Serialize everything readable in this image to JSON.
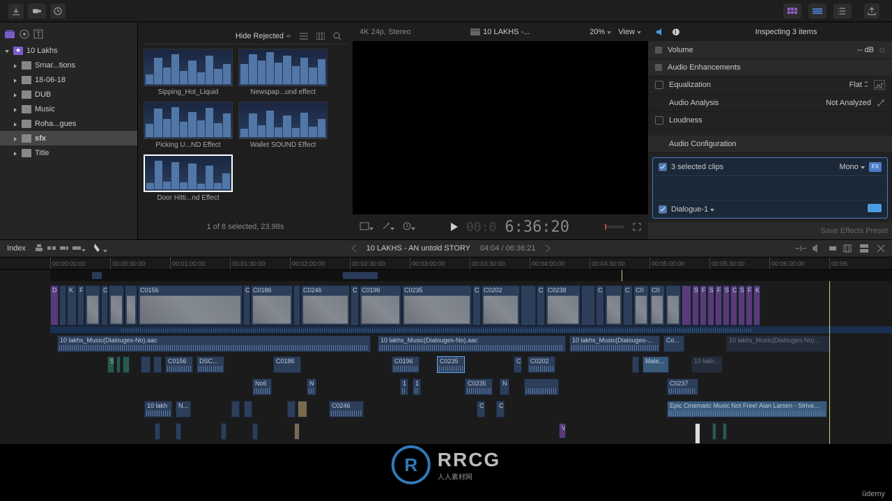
{
  "toolbar": {
    "hide_rejected": "Hide Rejected",
    "viewer_fmt": "4K 24p, Stereo",
    "project_name": "10 LAKHS -...",
    "zoom": "20%",
    "view": "View"
  },
  "sidebar": {
    "root": "10 Lakhs",
    "items": [
      {
        "label": "Smar...tions"
      },
      {
        "label": "18-06-18"
      },
      {
        "label": "DUB"
      },
      {
        "label": "Music"
      },
      {
        "label": "Roha...gues"
      },
      {
        "label": "sfx"
      },
      {
        "label": "Title"
      }
    ]
  },
  "browser": {
    "clips": [
      {
        "label": "Sipping_Hot_Liquid"
      },
      {
        "label": "Newspap...und effect"
      },
      {
        "label": "Picking U...ND Effect"
      },
      {
        "label": "Wallet SOUND Effect"
      },
      {
        "label": "Door Hitti...nd Effect"
      }
    ],
    "status": "1 of 8 selected, 23.98s"
  },
  "viewer": {
    "timecode": "6:36:20"
  },
  "inspector": {
    "title": "Inspecting 3 items",
    "volume_label": "Volume",
    "volume_val": "-- dB",
    "enh_label": "Audio Enhancements",
    "eq_label": "Equalization",
    "eq_val": "Flat",
    "analysis_label": "Audio Analysis",
    "analysis_val": "Not Analyzed",
    "loud_label": "Loudness",
    "config_label": "Audio Configuration",
    "sel_clips": "3 selected clips",
    "mono": "Mono",
    "dialogue": "Dialogue-1",
    "save_preset": "Save Effects Preset"
  },
  "midbar": {
    "index": "Index",
    "project": "10 LAKHS - AN untold STORY",
    "time": "04:04 / 06:36:21"
  },
  "ruler": [
    "00:00:00:00",
    "00:00:30:00",
    "00:01:00:00",
    "00:01:30:00",
    "00:02:00:00",
    "00:02:30:00",
    "00:03:00:00",
    "00:03:30:00",
    "00:04:00:00",
    "00:04:30:00",
    "00:05:00:00",
    "00:05:30:00",
    "00:06:00:00",
    "00:06:"
  ],
  "videoclips": [
    "D",
    "K",
    "F",
    "C",
    "C0156",
    "C",
    "C0186",
    "C0246",
    "C",
    "C0196",
    "C0235",
    "C",
    "C0202",
    "C",
    "C0238",
    "C",
    "C",
    "C0",
    "C0"
  ],
  "purpleclips": [
    "S",
    "F",
    "S",
    "F",
    "S",
    "C",
    "S",
    "F",
    "K"
  ],
  "musictrack": {
    "a": "10 lakhs_Music(Dialouges-No).aac",
    "b": "10 lakhs_Music(Dialouges-No).aac",
    "c": "10 lakhs_Music(Dialouges-...",
    "d": "Co...",
    "e": "10 lakhs_Music(Dialouges-No)..."
  },
  "audiolane2": {
    "s": "S",
    "c0156": "C0156",
    "dsc": "DSC...",
    "c0186": "C0186",
    "c0196": "C0196",
    "c0235": "C0235",
    "c": "C",
    "c0202": "C0202",
    "male": "Male...",
    "tenlak": "10 lakh..."
  },
  "audiolane3": {
    "no6": "No6",
    "n": "N",
    "one": "1",
    "one2": "1",
    "c0235": "C0235",
    "n2": "N",
    "c0237": "C0237"
  },
  "audiolane4": {
    "tenlakh": "10 lakh",
    "n": "N...",
    "c0246": "C0246",
    "c": "C",
    "c2": "C",
    "epic": "Epic Cinematic Music Not Free! Alan Larsen - Strive..."
  },
  "audiolane5": {
    "v": "V"
  },
  "watermark": {
    "logo": "R",
    "text": "RRCG",
    "sub": "人人素材网"
  },
  "udemy": "ûdemy"
}
